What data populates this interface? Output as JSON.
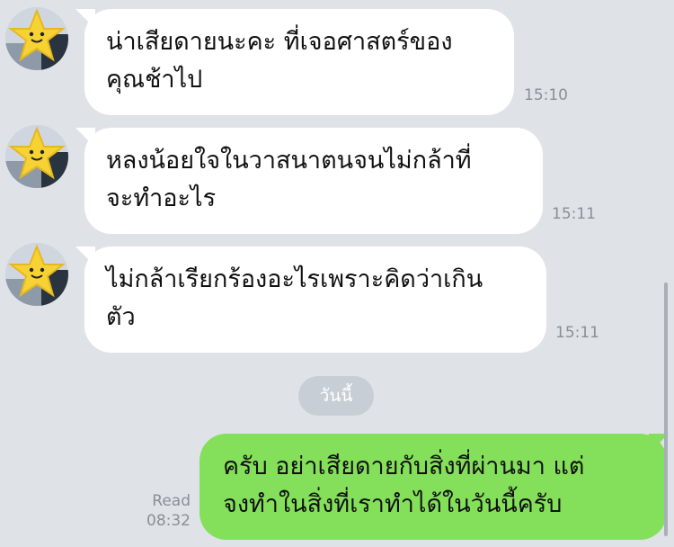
{
  "messages_in": [
    {
      "lines": [
        "น่าเสียดายนะคะ ที่เจอศาสตร์ของ",
        "คุณช้าไป"
      ],
      "time": "15:10",
      "avatar_icon": "star-avatar-icon"
    },
    {
      "lines": [
        "หลงน้อยใจในวาสนาตนจนไม่กล้าที่",
        "จะทำอะไร"
      ],
      "time": "15:11",
      "avatar_icon": "star-avatar-icon"
    },
    {
      "lines": [
        "ไม่กล้าเรียกร้องอะไรเพราะคิดว่าเกิน",
        "ตัว"
      ],
      "time": "15:11",
      "avatar_icon": "star-avatar-icon"
    }
  ],
  "date_divider": "วันนี้",
  "message_out": {
    "lines": [
      "ครับ อย่าเสียดายกับสิ่งที่ผ่านมา แต่",
      "จงทำในสิ่งที่เราทำได้ในวันนี้ครับ"
    ],
    "status": "Read",
    "time": "08:32"
  },
  "colors": {
    "background": "#dfe3e8",
    "incoming_bubble": "#ffffff",
    "outgoing_bubble": "#84e05a",
    "timestamp": "#8a8f96",
    "star": "#f7d234"
  }
}
